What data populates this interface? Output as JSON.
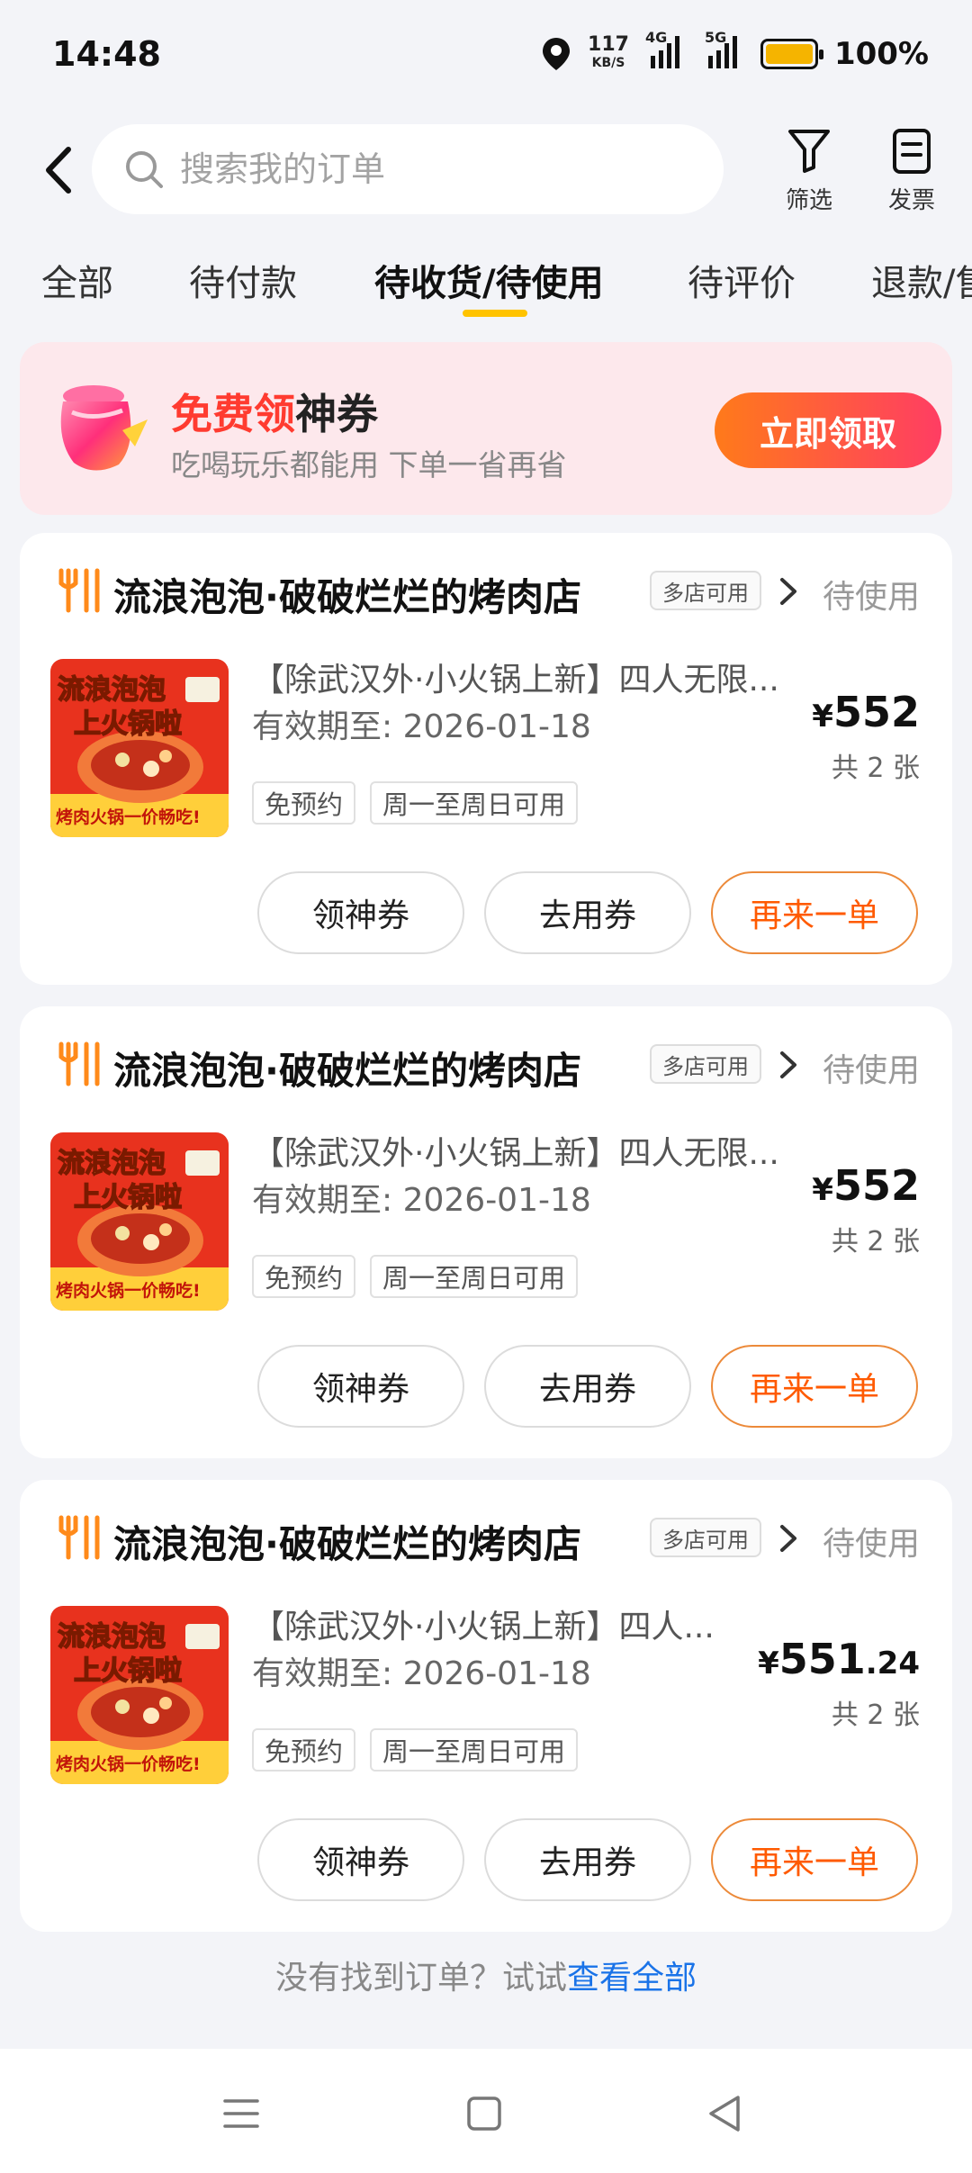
{
  "status_bar": {
    "time": "14:48",
    "speed_value": "117",
    "speed_unit": "KB/S",
    "net1": "4G",
    "net2": "5G",
    "battery": "100%"
  },
  "header": {
    "search_placeholder": "搜索我的订单",
    "filter_label": "筛选",
    "invoice_label": "发票"
  },
  "tabs": [
    {
      "label": "全部"
    },
    {
      "label": "待付款"
    },
    {
      "label": "待收货/待使用"
    },
    {
      "label": "待评价"
    },
    {
      "label": "退款/售后"
    }
  ],
  "promo": {
    "title_highlight": "免费领",
    "title_rest": "神券",
    "subtitle": "吃喝玩乐都能用 下单一省再省",
    "button": "立即领取"
  },
  "orders": [
    {
      "shop": "流浪泡泡·破破烂烂的烤肉店",
      "multi_tag": "多店可用",
      "status": "待使用",
      "title": "【除武汉外·小火锅上新】四人无限...",
      "expiry": "有效期至: 2026-01-18",
      "tag1": "免预约",
      "tag2": "周一至周日可用",
      "currency": "¥",
      "price_int": "552",
      "price_dec": "",
      "qty": "共 2 张",
      "btn1": "领神券",
      "btn2": "去用券",
      "btn3": "再来一单",
      "thumb_line1": "流浪泡泡",
      "thumb_line2": "上火锅啦",
      "thumb_line3": "烤肉火锅一价畅吃!"
    },
    {
      "shop": "流浪泡泡·破破烂烂的烤肉店",
      "multi_tag": "多店可用",
      "status": "待使用",
      "title": "【除武汉外·小火锅上新】四人无限...",
      "expiry": "有效期至: 2026-01-18",
      "tag1": "免预约",
      "tag2": "周一至周日可用",
      "currency": "¥",
      "price_int": "552",
      "price_dec": "",
      "qty": "共 2 张",
      "btn1": "领神券",
      "btn2": "去用券",
      "btn3": "再来一单",
      "thumb_line1": "流浪泡泡",
      "thumb_line2": "上火锅啦",
      "thumb_line3": "烤肉火锅一价畅吃!"
    },
    {
      "shop": "流浪泡泡·破破烂烂的烤肉店",
      "multi_tag": "多店可用",
      "status": "待使用",
      "title": "【除武汉外·小火锅上新】四人...",
      "expiry": "有效期至: 2026-01-18",
      "tag1": "免预约",
      "tag2": "周一至周日可用",
      "currency": "¥",
      "price_int": "551",
      "price_dec": ".24",
      "qty": "共 2 张",
      "btn1": "领神券",
      "btn2": "去用券",
      "btn3": "再来一单",
      "thumb_line1": "流浪泡泡",
      "thumb_line2": "上火锅啦",
      "thumb_line3": "烤肉火锅一价畅吃!"
    }
  ],
  "footer": {
    "hint": "没有找到订单？试试",
    "link": "查看全部"
  },
  "colors": {
    "accent_yellow": "#ffc300",
    "promo_bg": "#fde8ec",
    "reorder_orange": "#ff5a00",
    "link_blue": "#1a73e8"
  }
}
